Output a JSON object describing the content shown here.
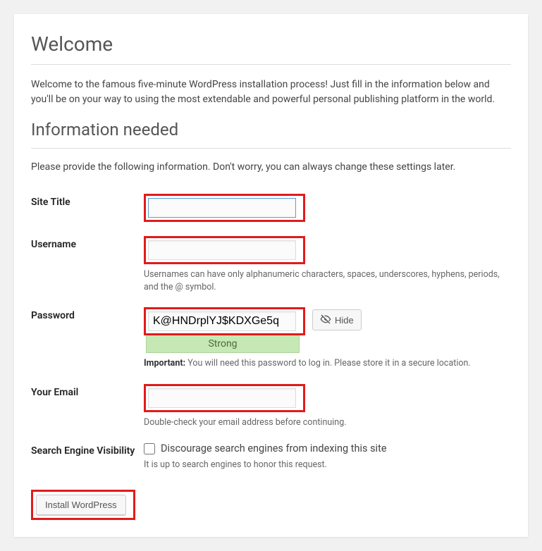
{
  "headings": {
    "welcome": "Welcome",
    "info_needed": "Information needed"
  },
  "intro": "Welcome to the famous five-minute WordPress installation process! Just fill in the information below and you'll be on your way to using the most extendable and powerful personal publishing platform in the world.",
  "sub": "Please provide the following information. Don't worry, you can always change these settings later.",
  "labels": {
    "site_title": "Site Title",
    "username": "Username",
    "password": "Password",
    "email": "Your Email",
    "sev": "Search Engine Visibility"
  },
  "values": {
    "site_title": "",
    "username": "",
    "password": "K@HNDrplYJ$KDXGe5q",
    "email": ""
  },
  "hints": {
    "username": "Usernames can have only alphanumeric characters, spaces, underscores, hyphens, periods, and the @ symbol.",
    "password_important_label": "Important:",
    "password_important": " You will need this password to log in. Please store it in a secure location.",
    "email": "Double-check your email address before continuing.",
    "sev": "It is up to search engines to honor this request."
  },
  "strength": "Strong",
  "buttons": {
    "hide": "Hide",
    "install": "Install WordPress"
  },
  "checkbox": {
    "sev_label": "Discourage search engines from indexing this site"
  }
}
